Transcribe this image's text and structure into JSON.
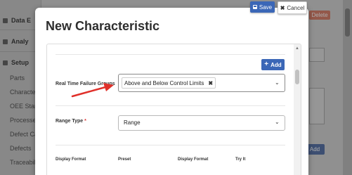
{
  "background": {
    "sidebar_items": [
      {
        "label": "Data E",
        "type": "head"
      },
      {
        "label": "Analy",
        "type": "head"
      },
      {
        "label": "Setup",
        "type": "head"
      },
      {
        "label": "Parts",
        "type": "item"
      },
      {
        "label": "Characte",
        "type": "item"
      },
      {
        "label": "OEE Stan",
        "type": "item"
      },
      {
        "label": "Processe",
        "type": "item"
      },
      {
        "label": "Defect Ca",
        "type": "item"
      },
      {
        "label": "Defects",
        "type": "item"
      },
      {
        "label": "Traceabil",
        "type": "item"
      }
    ],
    "delete_label": "Delete",
    "add_label": "Add"
  },
  "toolbar": {
    "save_label": "Save",
    "cancel_label": "Cancel"
  },
  "modal": {
    "title": "New Characteristic",
    "add_button_label": "Add",
    "real_time_failure_groups": {
      "label": "Real Time Failure Groups",
      "selected_tag": "Above and Below Control Limits"
    },
    "range_type": {
      "label": "Range Type",
      "required_mark": "*",
      "value": "Range"
    },
    "columns": [
      "Display Format",
      "Preset",
      "Display Format",
      "Try It"
    ]
  },
  "colors": {
    "primary": "#3b67b7",
    "danger": "#d9826d",
    "arrow": "#e0302a"
  },
  "icons": [
    "plus-icon",
    "times-icon",
    "chevron-down-icon",
    "save-icon",
    "arrow-annotation"
  ]
}
